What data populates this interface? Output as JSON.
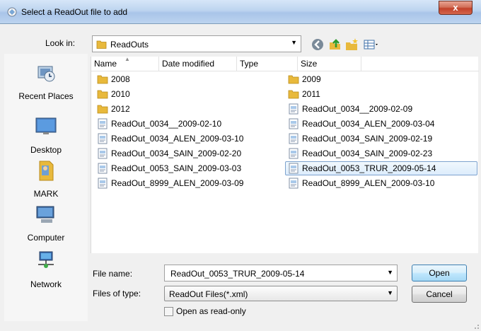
{
  "window": {
    "title": "Select a ReadOut file to add",
    "close_label": "x"
  },
  "lookin": {
    "label": "Look in:",
    "value": "ReadOuts"
  },
  "places": [
    {
      "label": "Recent Places",
      "icon": "recent-places-icon"
    },
    {
      "label": "Desktop",
      "icon": "desktop-icon"
    },
    {
      "label": "MARK",
      "icon": "user-folder-icon"
    },
    {
      "label": "Computer",
      "icon": "computer-icon"
    },
    {
      "label": "Network",
      "icon": "network-icon"
    }
  ],
  "columns": [
    "Name",
    "Date modified",
    "Type",
    "Size"
  ],
  "items": [
    {
      "name": "2008",
      "kind": "folder"
    },
    {
      "name": "2009",
      "kind": "folder"
    },
    {
      "name": "2010",
      "kind": "folder"
    },
    {
      "name": "2011",
      "kind": "folder"
    },
    {
      "name": "2012",
      "kind": "folder"
    },
    {
      "name": "ReadOut_0034__2009-02-09",
      "kind": "file"
    },
    {
      "name": "ReadOut_0034__2009-02-10",
      "kind": "file"
    },
    {
      "name": "ReadOut_0034_ALEN_2009-03-04",
      "kind": "file"
    },
    {
      "name": "ReadOut_0034_ALEN_2009-03-10",
      "kind": "file"
    },
    {
      "name": "ReadOut_0034_SAIN_2009-02-19",
      "kind": "file"
    },
    {
      "name": "ReadOut_0034_SAIN_2009-02-20",
      "kind": "file"
    },
    {
      "name": "ReadOut_0034_SAIN_2009-02-23",
      "kind": "file"
    },
    {
      "name": "ReadOut_0053_SAIN_2009-03-03",
      "kind": "file"
    },
    {
      "name": "ReadOut_0053_TRUR_2009-05-14",
      "kind": "file",
      "selected": true
    },
    {
      "name": "ReadOut_8999_ALEN_2009-03-09",
      "kind": "file"
    },
    {
      "name": "ReadOut_8999_ALEN_2009-03-10",
      "kind": "file"
    }
  ],
  "filename": {
    "label": "File name:",
    "value": "ReadOut_0053_TRUR_2009-05-14"
  },
  "filetype": {
    "label": "Files of type:",
    "value": "ReadOut Files(*.xml)"
  },
  "readonly": {
    "label": "Open as read-only",
    "checked": false
  },
  "buttons": {
    "open": "Open",
    "cancel": "Cancel"
  },
  "colors": {
    "selection": "#dcecfc",
    "titlebar": "#bdd4ef",
    "folder": "#e8b93c"
  }
}
